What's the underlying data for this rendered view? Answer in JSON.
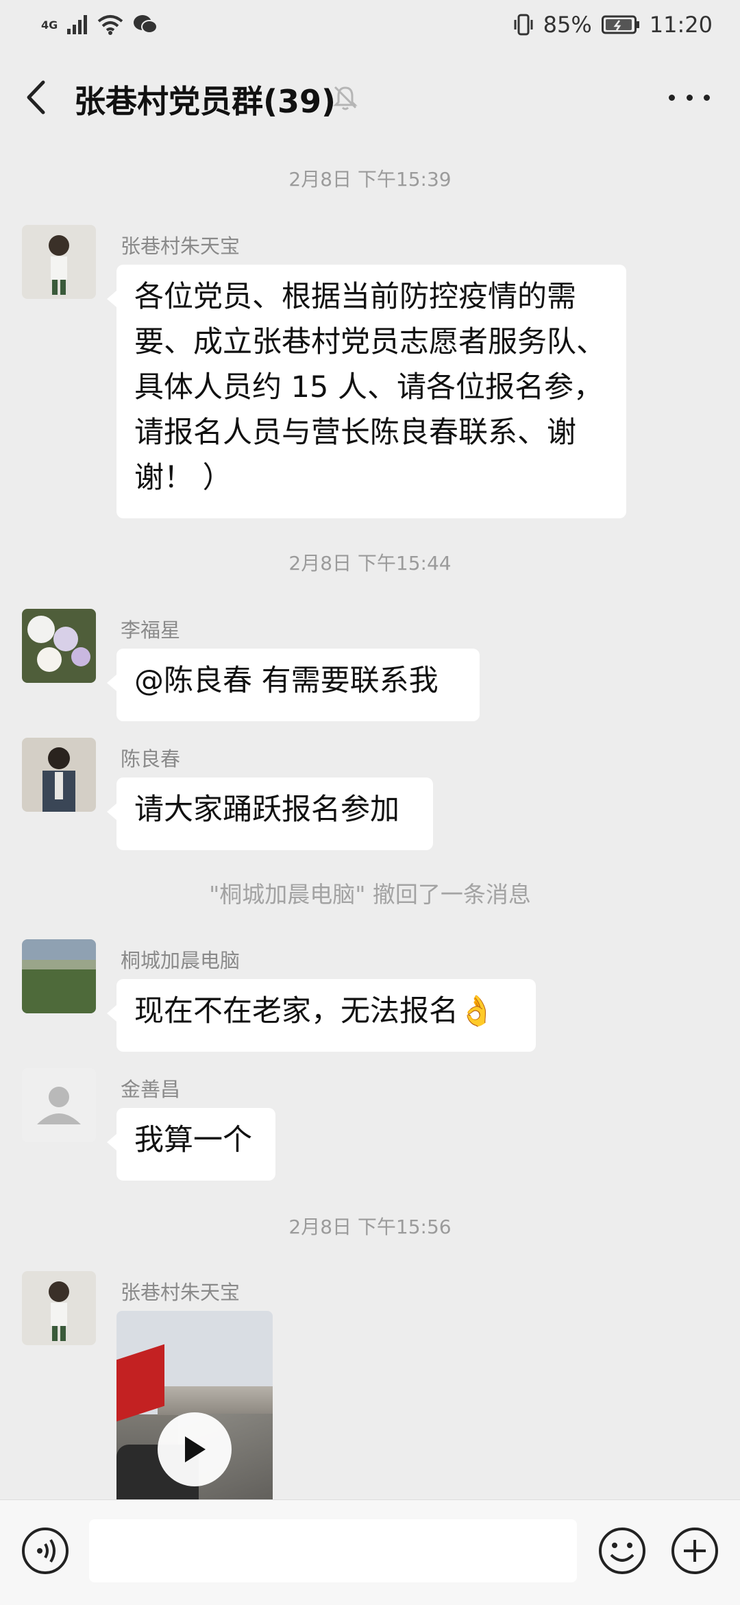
{
  "status_bar": {
    "network": "4G",
    "battery": "85%",
    "time": "11:20"
  },
  "header": {
    "title": "张巷村党员群(39)"
  },
  "messages": [
    {
      "type": "timestamp",
      "text": "2月8日 下午15:39"
    },
    {
      "type": "text",
      "sender": "张巷村朱天宝",
      "lines": [
        "各位党员、根据当前防控疫情的需",
        "要、成立张巷村党员志愿者服务队、",
        "具体人员约 15 人、请各位报名参，",
        "请报名人员与营长陈良春联系、谢",
        "谢！ ）"
      ]
    },
    {
      "type": "timestamp",
      "text": "2月8日 下午15:44"
    },
    {
      "type": "text",
      "sender": "李福星",
      "lines": [
        "@陈良春  有需要联系我"
      ]
    },
    {
      "type": "text",
      "sender": "陈良春",
      "lines": [
        "请大家踊跃报名参加"
      ]
    },
    {
      "type": "system",
      "text": "\"桐城加晨电脑\" 撤回了一条消息"
    },
    {
      "type": "text",
      "sender": "桐城加晨电脑",
      "lines": [
        "现在不在老家，无法报名"
      ],
      "emoji": "👌"
    },
    {
      "type": "text",
      "sender": "金善昌",
      "lines": [
        "我算一个"
      ]
    },
    {
      "type": "timestamp",
      "text": "2月8日 下午15:56"
    },
    {
      "type": "video",
      "sender": "张巷村朱天宝"
    }
  ],
  "input_bar": {
    "icons": [
      "voice-icon",
      "emoji-icon",
      "plus-icon"
    ]
  }
}
